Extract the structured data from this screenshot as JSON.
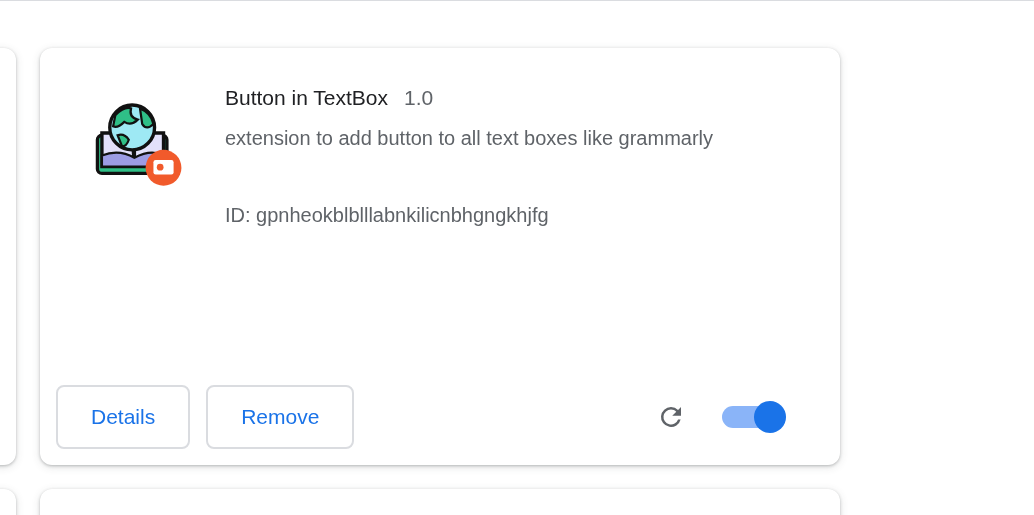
{
  "extension": {
    "name": "Button in TextBox",
    "version": "1.0",
    "description": "extension to add button to all text boxes like grammarly",
    "id": "ID: gpnheokblblllabnkilicnbhgngkhjfg",
    "buttons": [
      "Details",
      "Remove"
    ],
    "enabled": true
  }
}
